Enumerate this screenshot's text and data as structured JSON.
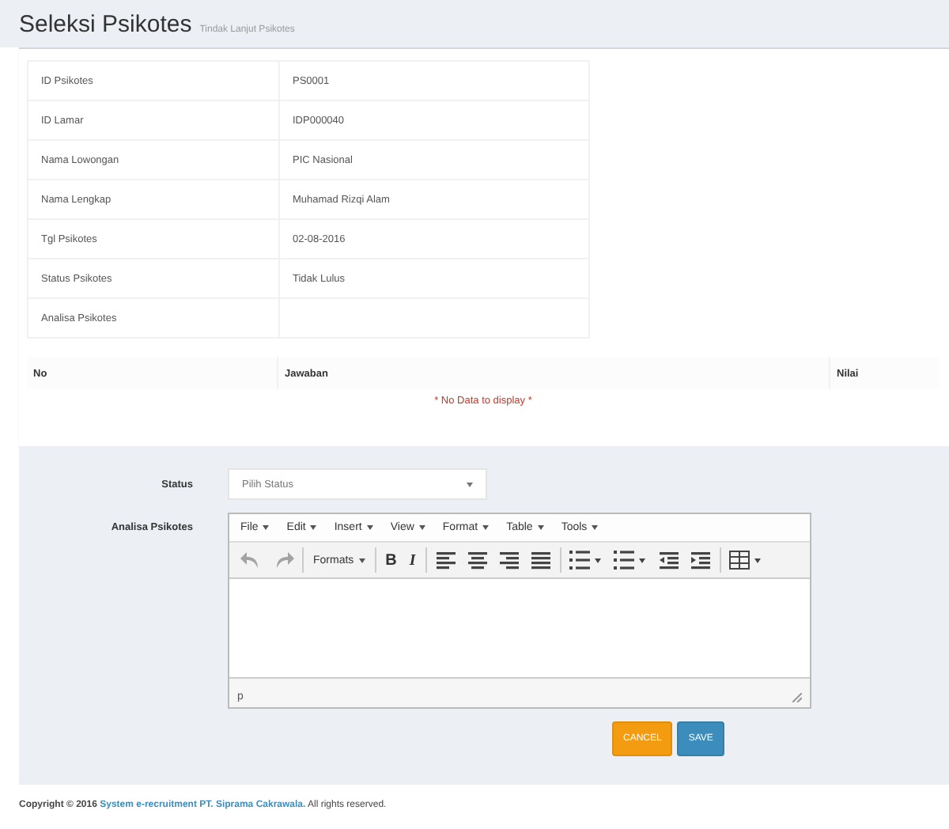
{
  "header": {
    "title": "Seleksi Psikotes",
    "subtitle": "Tindak Lanjut Psikotes"
  },
  "details": [
    {
      "label": "ID Psikotes",
      "value": "PS0001"
    },
    {
      "label": "ID Lamar",
      "value": "IDP000040"
    },
    {
      "label": "Nama Lowongan",
      "value": "PIC Nasional"
    },
    {
      "label": "Nama Lengkap",
      "value": "Muhamad Rizqi Alam"
    },
    {
      "label": "Tgl Psikotes",
      "value": "02-08-2016"
    },
    {
      "label": "Status Psikotes",
      "value": "Tidak Lulus"
    },
    {
      "label": "Analisa Psikotes"
    }
  ],
  "answers_table": {
    "columns": [
      "No",
      "Jawaban",
      "Nilai"
    ],
    "empty_message": "* No Data to display *"
  },
  "form": {
    "status_label": "Status",
    "status_placeholder": "Pilih Status",
    "analysis_label": "Analisa Psikotes"
  },
  "editor": {
    "menus": [
      "File",
      "Edit",
      "Insert",
      "View",
      "Format",
      "Table",
      "Tools"
    ],
    "toolbar": [
      {
        "kind": "undo",
        "disabled": true
      },
      {
        "kind": "redo",
        "disabled": true
      },
      {
        "kind": "sep"
      },
      {
        "kind": "dropdown",
        "label": "Formats"
      },
      {
        "kind": "sep"
      },
      {
        "kind": "bold",
        "label": "B"
      },
      {
        "kind": "italic",
        "label": "I"
      },
      {
        "kind": "sep"
      },
      {
        "kind": "align-left"
      },
      {
        "kind": "align-center"
      },
      {
        "kind": "align-right"
      },
      {
        "kind": "align-justify"
      },
      {
        "kind": "sep"
      },
      {
        "kind": "bullets"
      },
      {
        "kind": "numbers"
      },
      {
        "kind": "outdent"
      },
      {
        "kind": "indent"
      },
      {
        "kind": "sep"
      },
      {
        "kind": "table"
      }
    ],
    "path": "p"
  },
  "buttons": [
    {
      "kind": "cancel",
      "label": "CANCEL"
    },
    {
      "kind": "save",
      "label": "SAVE"
    }
  ],
  "footer": {
    "prefix": "**Copyright © 2016**",
    "link": "System e-recruitment PT. Siprama Cakrawala.",
    "suffix": "All rights reserved."
  }
}
